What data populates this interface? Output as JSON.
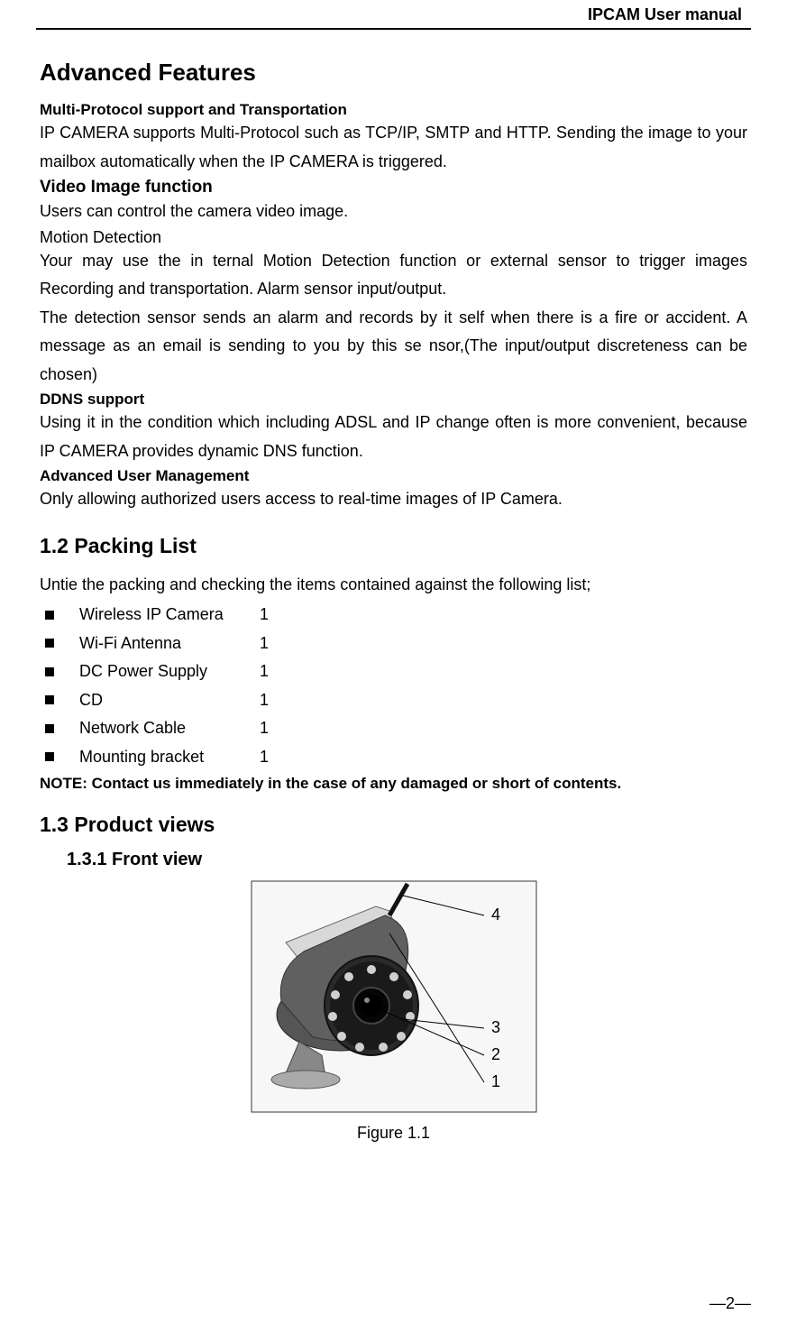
{
  "header": {
    "title": "IPCAM User manual"
  },
  "sections": {
    "advanced": {
      "heading": "Advanced Features",
      "multi_protocol_heading": "Multi-Protocol support and Transportation",
      "multi_protocol_body": "IP CAMERA supports Multi-Protocol such as TCP/IP, SMTP and HTTP. Sending the image to your mailbox automatically when the IP CAMERA is triggered.",
      "video_image_heading": "Video Image function",
      "video_image_body": "Users can control the camera video image.",
      "motion_heading": " Motion Detection",
      "motion_body1": "Your may use the in  ternal Motion Detection function or external sensor  to trigger images Recording and transportation. Alarm sensor input/output.",
      "motion_body2": "The detection sensor  sends an alarm and records by it  self when there is a  fire or accident. A message as an email is sending to  you by this se nsor,(The input/output discreteness can be chosen)",
      "ddns_heading": "DDNS support",
      "ddns_body": "Using it in the condition which including ADSL and IP change often is more convenient, because IP CAMERA provides dynamic DNS function.",
      "user_mgmt_heading": "Advanced User Management",
      "user_mgmt_body": "Only allowing authorized users access to real-time images of IP Camera."
    },
    "packing": {
      "heading": "1.2 Packing List",
      "intro": "Untie the packing and checking the items contained against the following list;",
      "items": [
        {
          "label": "Wireless IP Camera",
          "qty": "1"
        },
        {
          "label": "Wi-Fi Antenna",
          "qty": "1"
        },
        {
          "label": "DC Power Supply",
          "qty": "1"
        },
        {
          "label": "CD",
          "qty": "1"
        },
        {
          "label": "Network Cable",
          "qty": "1"
        },
        {
          "label": "Mounting bracket",
          "qty": "1"
        }
      ],
      "note_prefix": "NOTE: ",
      "note_text": "Contact us immediately in the case of any damaged or short of contents."
    },
    "views": {
      "heading": "1.3 Product views",
      "sub_heading": "1.3.1 Front view",
      "figure_caption": "Figure 1.1",
      "callout_4": "4",
      "callout_3": "3",
      "callout_2": "2",
      "callout_1": "1"
    }
  },
  "footer": {
    "page": "—2—"
  }
}
